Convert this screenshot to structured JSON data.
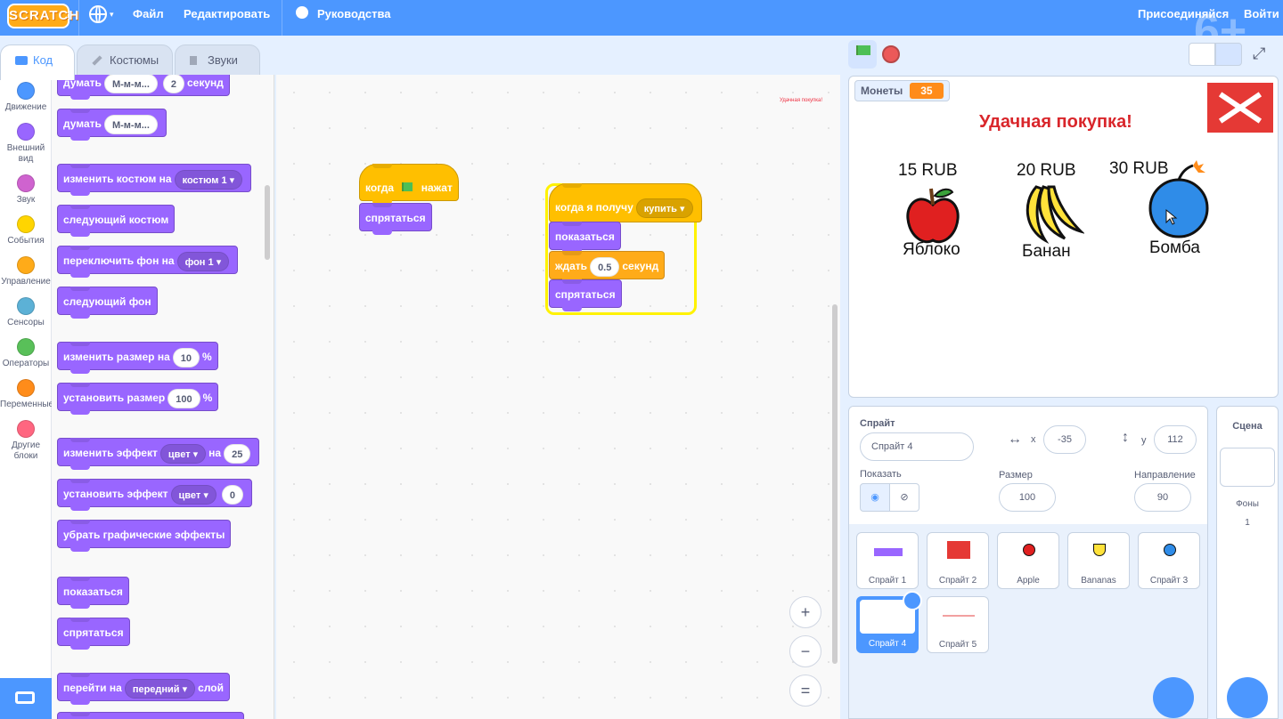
{
  "menu": {
    "logo": "SCRATCH",
    "file": "Файл",
    "edit": "Редактировать",
    "tutorials": "Руководства",
    "join": "Присоединяйся",
    "signin": "Войти",
    "watermark": "6+"
  },
  "tabs": {
    "code": "Код",
    "costumes": "Костюмы",
    "sounds": "Звуки"
  },
  "categories": [
    {
      "label": "Движение",
      "color": "#4c97ff"
    },
    {
      "label": "Внешний вид",
      "color": "#9966ff"
    },
    {
      "label": "Звук",
      "color": "#cf63cf"
    },
    {
      "label": "События",
      "color": "#ffd500"
    },
    {
      "label": "Управление",
      "color": "#ffab19"
    },
    {
      "label": "Сенсоры",
      "color": "#5cb1d6"
    },
    {
      "label": "Операторы",
      "color": "#59c059"
    },
    {
      "label": "Переменные",
      "color": "#ff8c1a"
    },
    {
      "label": "Другие блоки",
      "color": "#ff6680"
    }
  ],
  "palette": {
    "think_secs": {
      "text": "думать",
      "msg": "М-м-м...",
      "secs": "2",
      "unit": "секунд"
    },
    "think": {
      "text": "думать",
      "msg": "М-м-м..."
    },
    "switch_costume": {
      "text": "изменить костюм на",
      "value": "костюм 1"
    },
    "next_costume": "следующий костюм",
    "switch_backdrop": {
      "text": "переключить фон на",
      "value": "фон 1"
    },
    "next_backdrop": "следующий фон",
    "change_size": {
      "text": "изменить размер на",
      "value": "10",
      "unit": "%"
    },
    "set_size": {
      "text": "установить размер",
      "value": "100",
      "unit": "%"
    },
    "change_effect": {
      "text": "изменить эффект",
      "effect": "цвет",
      "by": "на",
      "value": "25"
    },
    "set_effect": {
      "text": "установить эффект",
      "effect": "цвет",
      "value": "0"
    },
    "clear_effects": "убрать графические эффекты",
    "show": "показаться",
    "hide": "спрятаться",
    "go_layer": {
      "text": "перейти на",
      "value": "передний",
      "unit": "слой"
    }
  },
  "scripts": {
    "flag_script": {
      "when": "когда",
      "clicked": "нажат",
      "hide": "спрятаться"
    },
    "receive_script": {
      "when_receive": "когда я получу",
      "message": "купить",
      "show": "показаться",
      "wait": "ждать",
      "wait_value": "0.5",
      "wait_unit": "секунд",
      "hide": "спрятаться"
    },
    "tiny_label": "Удачная покупка!"
  },
  "zoom": {
    "in": "+",
    "out": "−",
    "reset": "="
  },
  "stage": {
    "monitor_label": "Монеты",
    "monitor_value": "35",
    "message": "Удачная покупка!",
    "items": [
      {
        "price": "15 RUB",
        "name": "Яблоко"
      },
      {
        "price": "20 RUB",
        "name": "Банан"
      },
      {
        "price": "30 RUB",
        "name": "Бомба"
      }
    ]
  },
  "sprite_info": {
    "sprite_label": "Спрайт",
    "sprite_name": "Спрайт 4",
    "x_label": "x",
    "x_value": "-35",
    "y_label": "y",
    "y_value": "112",
    "show_label": "Показать",
    "size_label": "Размер",
    "size_value": "100",
    "direction_label": "Направление",
    "direction_value": "90"
  },
  "sprites": [
    {
      "name": "Спрайт 1"
    },
    {
      "name": "Спрайт 2"
    },
    {
      "name": "Apple"
    },
    {
      "name": "Bananas"
    },
    {
      "name": "Спрайт 3"
    },
    {
      "name": "Спрайт 4",
      "selected": true
    },
    {
      "name": "Спрайт 5"
    }
  ],
  "scene": {
    "title": "Сцена",
    "backdrops_label": "Фоны",
    "backdrops_count": "1"
  }
}
